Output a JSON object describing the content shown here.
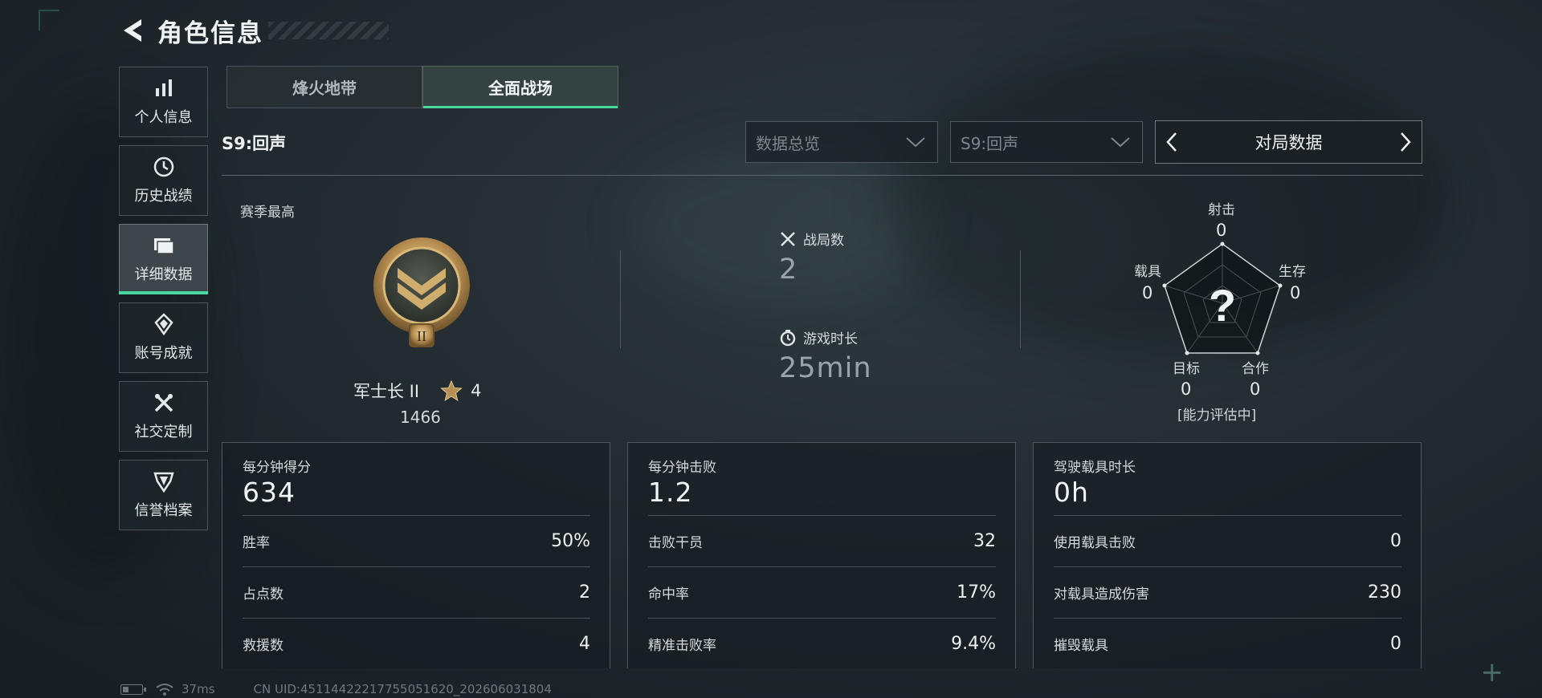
{
  "header": {
    "title": "角色信息"
  },
  "sidebar": {
    "items": [
      {
        "label": "个人信息",
        "icon": "bar-chart-icon"
      },
      {
        "label": "历史战绩",
        "icon": "history-clock-icon"
      },
      {
        "label": "详细数据",
        "icon": "folder-stack-icon",
        "active": true
      },
      {
        "label": "账号成就",
        "icon": "achievement-icon"
      },
      {
        "label": "社交定制",
        "icon": "wrench-tools-icon"
      },
      {
        "label": "信誉档案",
        "icon": "shield-badge-icon"
      }
    ]
  },
  "mode_tabs": [
    {
      "label": "烽火地带"
    },
    {
      "label": "全面战场",
      "active": true
    }
  ],
  "season": {
    "label": "S9:回声"
  },
  "filters": {
    "data_type": "数据总览",
    "season": "S9:回声",
    "stat_nav_title": "对局数据"
  },
  "season_best": {
    "label": "赛季最高",
    "rank": "军士长 II",
    "stars": "4",
    "score": "1466"
  },
  "mid_stats": {
    "matches_label": "战局数",
    "matches_value": "2",
    "playtime_label": "游戏时长",
    "playtime_value": "25min"
  },
  "radar": {
    "top_label": "射击",
    "top_value": "0",
    "right_label": "生存",
    "right_value": "0",
    "left_label": "载具",
    "left_value": "0",
    "bottom_left_label": "目标",
    "bottom_left_value": "0",
    "bottom_right_label": "合作",
    "bottom_right_value": "0",
    "center_symbol": "?",
    "status": "[能力评估中]"
  },
  "cards": [
    {
      "head": "每分钟得分",
      "big": "634",
      "rows": [
        {
          "label": "胜率",
          "value": "50%"
        },
        {
          "label": "占点数",
          "value": "2"
        },
        {
          "label": "救援数",
          "value": "4"
        }
      ]
    },
    {
      "head": "每分钟击败",
      "big": "1.2",
      "rows": [
        {
          "label": "击败干员",
          "value": "32"
        },
        {
          "label": "命中率",
          "value": "17%"
        },
        {
          "label": "精准击败率",
          "value": "9.4%"
        }
      ]
    },
    {
      "head": "驾驶载具时长",
      "big": "0h",
      "rows": [
        {
          "label": "使用载具击败",
          "value": "0"
        },
        {
          "label": "对载具造成伤害",
          "value": "230"
        },
        {
          "label": "摧毁载具",
          "value": "0"
        }
      ]
    }
  ],
  "footer": {
    "ping": "37ms",
    "uid": "CN UID:451144222177550516​20_202606031804"
  },
  "colors": {
    "accent": "#49d7a2",
    "panel": "#1a2124"
  }
}
